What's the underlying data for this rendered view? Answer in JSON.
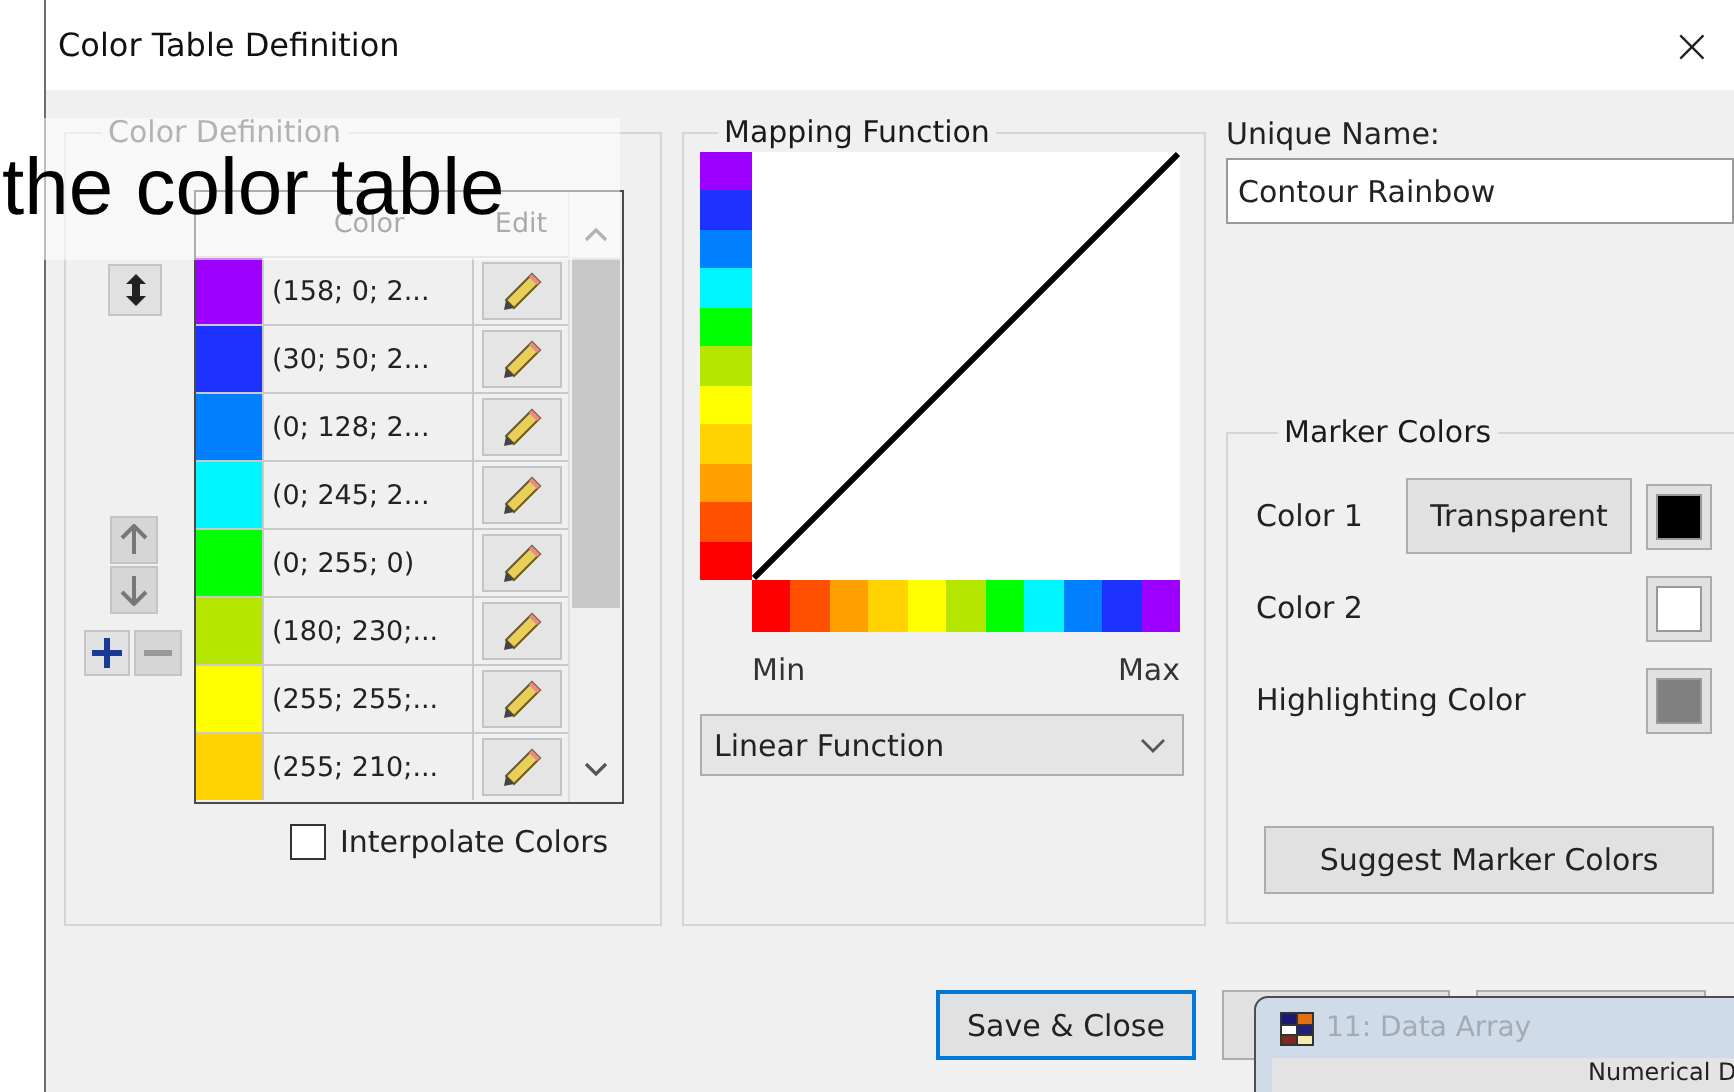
{
  "window": {
    "title": "Color Table Definition",
    "close": "×"
  },
  "overlay_caption": "the color table",
  "color_definition": {
    "title": "Color Definition",
    "columns": [
      "Color",
      "Edit"
    ],
    "rows": [
      {
        "color": "#9e00ff",
        "value": "(158; 0; 2..."
      },
      {
        "color": "#1e32ff",
        "value": "(30; 50; 2..."
      },
      {
        "color": "#0080ff",
        "value": "(0; 128; 2..."
      },
      {
        "color": "#00f5ff",
        "value": "(0; 245; 2..."
      },
      {
        "color": "#00ff00",
        "value": "(0; 255; 0)"
      },
      {
        "color": "#b4e600",
        "value": "(180; 230;..."
      },
      {
        "color": "#ffff00",
        "value": "(255; 255;..."
      },
      {
        "color": "#ffd200",
        "value": "(255; 210;..."
      }
    ],
    "interpolate": {
      "label": "Interpolate Colors",
      "checked": false
    }
  },
  "mapping_function": {
    "title": "Mapping Function",
    "colors": [
      {
        "color": "#ff0000"
      },
      {
        "color": "#ff5000"
      },
      {
        "color": "#ffa000"
      },
      {
        "color": "#ffd200"
      },
      {
        "color": "#ffff00"
      },
      {
        "color": "#b4e600"
      },
      {
        "color": "#00ff00"
      },
      {
        "color": "#00f5ff"
      },
      {
        "color": "#0080ff"
      },
      {
        "color": "#1e32ff"
      },
      {
        "color": "#9e00ff"
      }
    ],
    "min_label": "Min",
    "max_label": "Max",
    "function": "Linear Function"
  },
  "unique_name": {
    "label": "Unique Name:",
    "value": "Contour Rainbow"
  },
  "marker_colors": {
    "title": "Marker Colors",
    "items": [
      {
        "label": "Color 1",
        "button": "Transparent",
        "color": "#000000"
      },
      {
        "label": "Color 2",
        "color": "#ffffff"
      },
      {
        "label": "Highlighting Color",
        "color": "#808080"
      }
    ],
    "suggest_button": "Suggest Marker Colors"
  },
  "buttons": [
    {
      "label": "Save & Close",
      "focused": true
    },
    {
      "focused": false
    },
    {
      "focused": false
    }
  ],
  "background_window": {
    "title": "11: Data Array",
    "text": "Numerical D"
  }
}
